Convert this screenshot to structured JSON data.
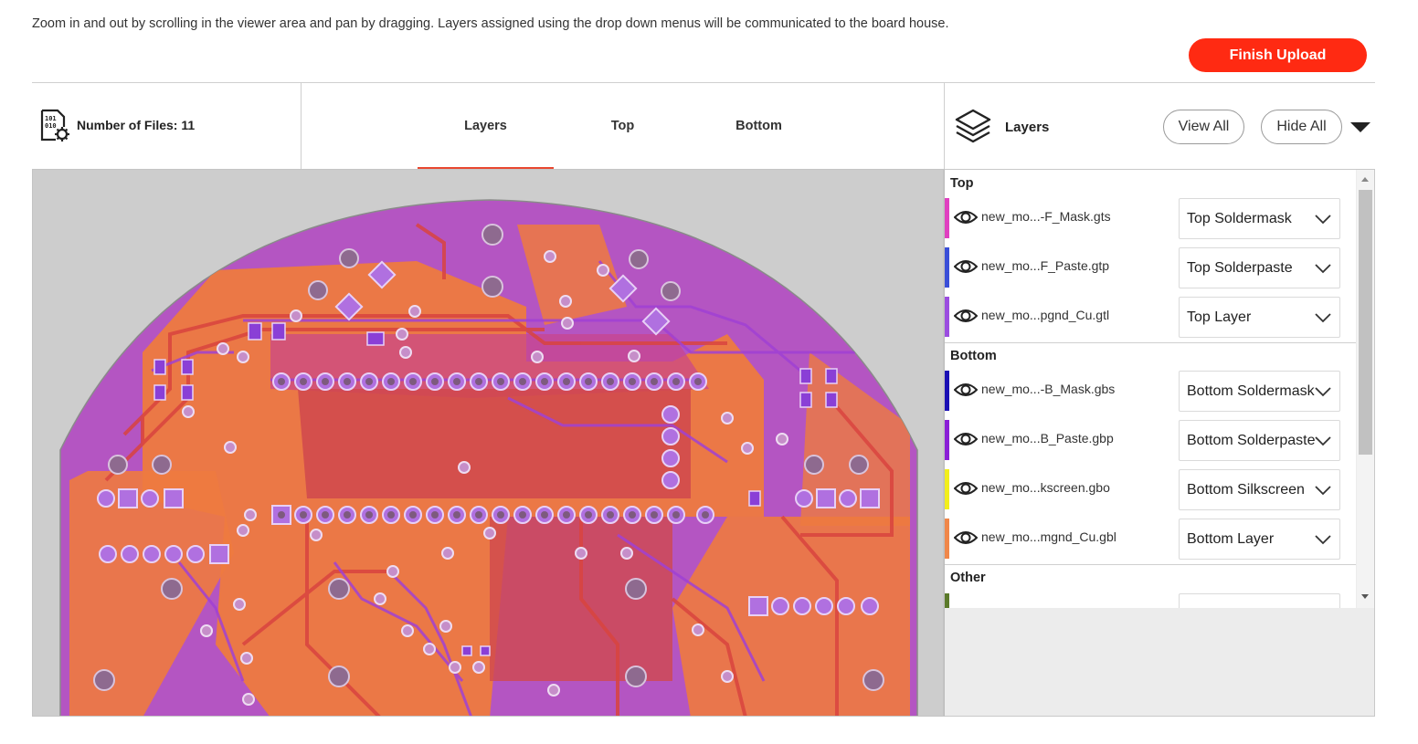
{
  "instructions": "Zoom in and out by scrolling in the viewer area and pan by dragging. Layers assigned using the drop down menus will be communicated to the board house.",
  "finish_button": "Finish Upload",
  "files": {
    "label": "Number of Files: 11"
  },
  "tabs": [
    {
      "label": "Layers",
      "active": true
    },
    {
      "label": "Top",
      "active": false
    },
    {
      "label": "Bottom",
      "active": false
    }
  ],
  "layers_panel": {
    "title": "Layers",
    "view_all": "View All",
    "hide_all": "Hide All"
  },
  "groups": [
    {
      "title": "Top",
      "rows": [
        {
          "file": "new_mo...-F_Mask.gts",
          "layer": "Top Soldermask",
          "color": "#e040c0"
        },
        {
          "file": "new_mo...F_Paste.gtp",
          "layer": "Top Solderpaste",
          "color": "#3a4fd8"
        },
        {
          "file": "new_mo...pgnd_Cu.gtl",
          "layer": "Top Layer",
          "color": "#9b4de0"
        }
      ]
    },
    {
      "title": "Bottom",
      "rows": [
        {
          "file": "new_mo...-B_Mask.gbs",
          "layer": "Bottom Soldermask",
          "color": "#1a0fb4"
        },
        {
          "file": "new_mo...B_Paste.gbp",
          "layer": "Bottom Solderpaste",
          "color": "#8a1fd6"
        },
        {
          "file": "new_mo...kscreen.gbo",
          "layer": "Bottom Silkscreen",
          "color": "#f2ee1c"
        },
        {
          "file": "new_mo...mgnd_Cu.gbl",
          "layer": "Bottom Layer",
          "color": "#f0874a"
        }
      ]
    },
    {
      "title": "Other",
      "rows": []
    }
  ],
  "colors": {
    "accent": "#ff2a12",
    "tab_underline": "#e8472f",
    "board_purple": "#b455c2",
    "copper_orange": "#ee7a3f",
    "pad_purple": "#b070e0"
  }
}
